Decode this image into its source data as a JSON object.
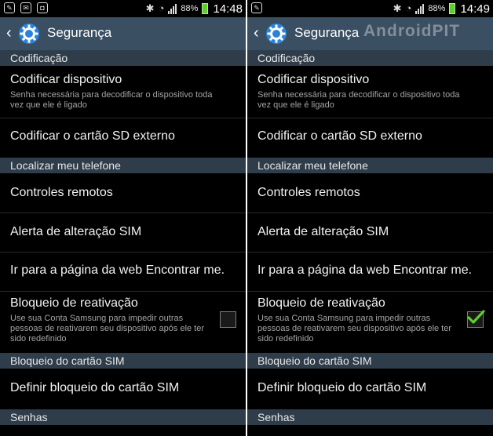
{
  "panels": [
    {
      "status": {
        "battery": "88%",
        "time": "14:48"
      },
      "action_bar": {
        "title": "Segurança",
        "watermark": ""
      },
      "sections": {
        "encryption": "Codificação",
        "find_phone": "Localizar meu telefone",
        "sim_lock": "Bloqueio do cartão SIM",
        "passwords": "Senhas"
      },
      "items": {
        "encrypt_device": {
          "title": "Codificar dispositivo",
          "summary": "Senha necessária para decodificar o dispositivo toda vez que ele é ligado"
        },
        "encrypt_sd": {
          "title": "Codificar o cartão SD externo"
        },
        "remote_controls": {
          "title": "Controles remotos"
        },
        "sim_change_alert": {
          "title": "Alerta de alteração SIM"
        },
        "find_my_mobile_page": {
          "title": "Ir para a página da web Encontrar me."
        },
        "reactivation_lock": {
          "title": "Bloqueio de reativação",
          "summary": "Use sua Conta Samsung para impedir outras pessoas de reativarem seu dispositivo após ele ter sido redefinido",
          "checked": false
        },
        "set_sim_lock": {
          "title": "Definir bloqueio do cartão SIM"
        }
      }
    },
    {
      "status": {
        "battery": "88%",
        "time": "14:49"
      },
      "action_bar": {
        "title": "Segurança",
        "watermark": "AndroidPIT"
      },
      "sections": {
        "encryption": "Codificação",
        "find_phone": "Localizar meu telefone",
        "sim_lock": "Bloqueio do cartão SIM",
        "passwords": "Senhas"
      },
      "items": {
        "encrypt_device": {
          "title": "Codificar dispositivo",
          "summary": "Senha necessária para decodificar o dispositivo toda vez que ele é ligado"
        },
        "encrypt_sd": {
          "title": "Codificar o cartão SD externo"
        },
        "remote_controls": {
          "title": "Controles remotos"
        },
        "sim_change_alert": {
          "title": "Alerta de alteração SIM"
        },
        "find_my_mobile_page": {
          "title": "Ir para a página da web Encontrar me."
        },
        "reactivation_lock": {
          "title": "Bloqueio de reativação",
          "summary": "Use sua Conta Samsung para impedir outras pessoas de reativarem seu dispositivo após ele ter sido redefinido",
          "checked": true
        },
        "set_sim_lock": {
          "title": "Definir bloqueio do cartão SIM"
        }
      }
    }
  ],
  "colors": {
    "action_bar": "#3b4f63",
    "section_header": "#2f3d4a",
    "check": "#5bd02a",
    "battery": "#5bd02a"
  }
}
